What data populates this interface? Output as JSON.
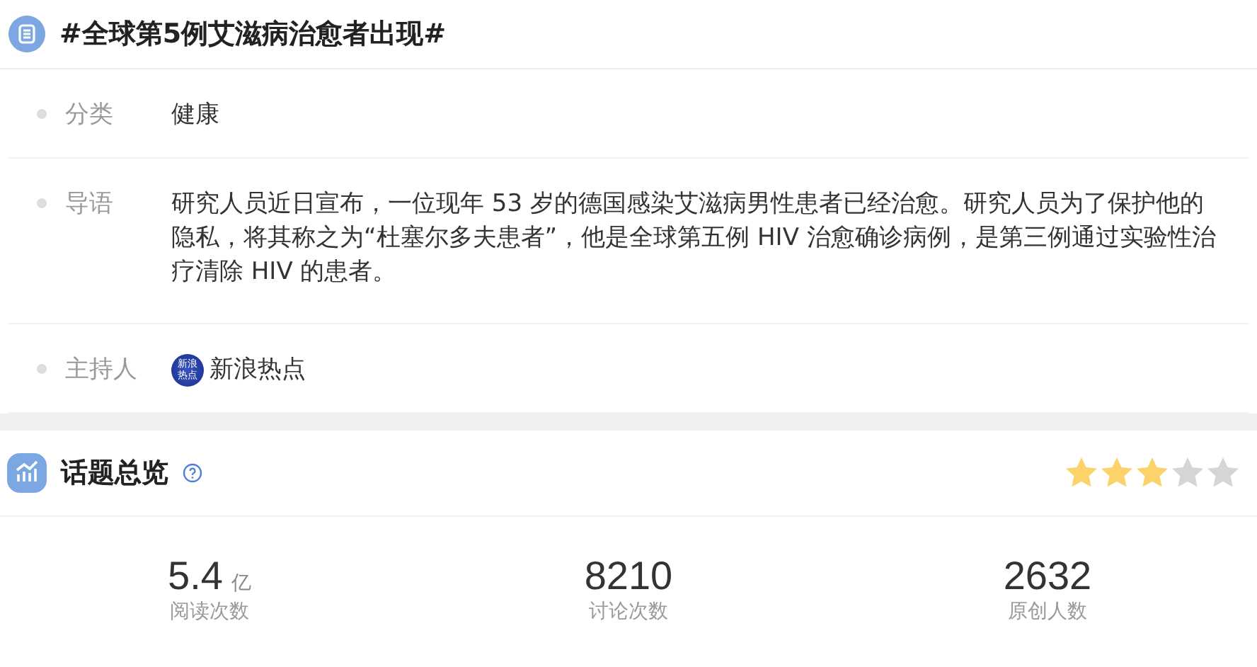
{
  "topic": {
    "title": "#全球第5例艾滋病治愈者出现#",
    "fields": [
      {
        "kind": "text",
        "label": "分类",
        "value": "健康"
      },
      {
        "kind": "text",
        "label": "导语",
        "value": "研究人员近日宣布，一位现年 53 岁的德国感染艾滋病男性患者已经治愈。研究人员为了保护他的隐私，将其称之为“杜塞尔多夫患者”，他是全球第五例 HIV 治愈确诊病例，是第三例通过实验性治疗清除 HIV 的患者。"
      },
      {
        "kind": "host",
        "label": "主持人",
        "value": "新浪热点",
        "avatar_text": "新浪热点"
      }
    ]
  },
  "overview": {
    "title": "话题总览",
    "stars": 3,
    "stats": [
      {
        "value": "5.4",
        "unit": "亿",
        "label": "阅读次数"
      },
      {
        "value": "8210",
        "label": "讨论次数"
      },
      {
        "value": "2632",
        "label": "原创人数"
      }
    ]
  }
}
